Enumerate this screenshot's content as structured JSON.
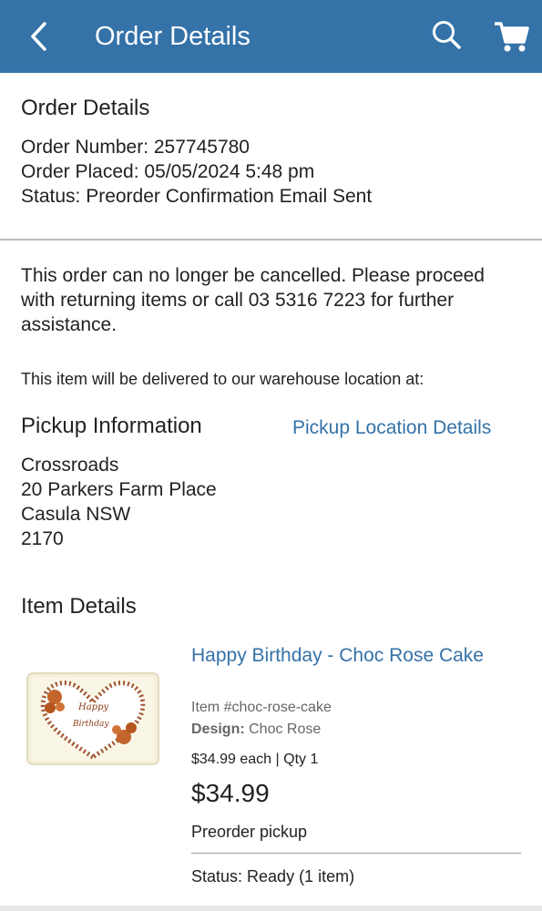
{
  "header": {
    "title": "Order Details",
    "back_icon": "chevron-left-icon",
    "search_icon": "search-icon",
    "cart_icon": "cart-icon",
    "background": "#3472a8"
  },
  "order": {
    "section_title": "Order Details",
    "number_line": "Order Number: 257745780",
    "placed_line": "Order Placed: 05/05/2024 5:48 pm",
    "status_line": "Status: Preorder Confirmation Email Sent"
  },
  "notice": {
    "cancel_text": "This order can no longer be cancelled. Please proceed with returning items or call 03 5316 7223 for further assistance.",
    "delivery_text": "This item will be delivered to our warehouse location at:"
  },
  "pickup": {
    "title": "Pickup Information",
    "details_link": "Pickup Location Details",
    "address": [
      "Crossroads",
      "20 Parkers Farm Place",
      "Casula NSW",
      "2170"
    ]
  },
  "items": {
    "section_title": "Item Details",
    "list": [
      {
        "title": "Happy Birthday - Choc Rose Cake",
        "item_number": "Item #choc-rose-cake",
        "design_label": "Design:",
        "design_value": "Choc Rose",
        "price_qty": "$34.99 each | Qty 1",
        "total": "$34.99",
        "fulfillment": "Preorder pickup",
        "status": "Status: Ready (1 item)",
        "image_text": [
          "Happy",
          "Birthday"
        ]
      }
    ]
  },
  "colors": {
    "accent": "#3472a8",
    "text": "#222222",
    "muted": "#666666"
  }
}
